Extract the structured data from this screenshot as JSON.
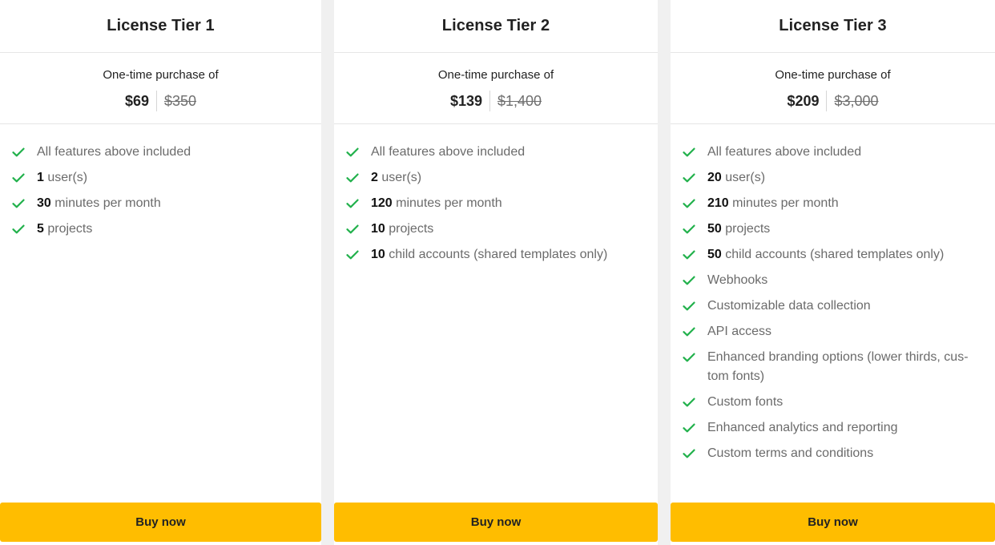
{
  "tiers": [
    {
      "title": "License Tier 1",
      "price_caption": "One-time purchase of",
      "price_now": "$69",
      "price_old": "$350",
      "features": [
        {
          "bold": "",
          "text": "All features above included"
        },
        {
          "bold": "1",
          "text": " user(s)"
        },
        {
          "bold": "30",
          "text": " minutes per month"
        },
        {
          "bold": "5",
          "text": " projects"
        }
      ],
      "button_label": "Buy now"
    },
    {
      "title": "License Tier 2",
      "price_caption": "One-time purchase of",
      "price_now": "$139",
      "price_old": "$1,400",
      "features": [
        {
          "bold": "",
          "text": "All features above included"
        },
        {
          "bold": "2",
          "text": " user(s)"
        },
        {
          "bold": "120",
          "text": " minutes per month"
        },
        {
          "bold": "10",
          "text": " projects"
        },
        {
          "bold": "10",
          "text": " child accounts (shared templates only)"
        }
      ],
      "button_label": "Buy now"
    },
    {
      "title": "License Tier 3",
      "price_caption": "One-time purchase of",
      "price_now": "$209",
      "price_old": "$3,000",
      "features": [
        {
          "bold": "",
          "text": "All features above included"
        },
        {
          "bold": "20",
          "text": " user(s)"
        },
        {
          "bold": "210",
          "text": " minutes per month"
        },
        {
          "bold": "50",
          "text": " projects"
        },
        {
          "bold": "50",
          "text": " child accounts (shared templates only)"
        },
        {
          "bold": "",
          "text": "Webhooks"
        },
        {
          "bold": "",
          "text": "Customizable data collection"
        },
        {
          "bold": "",
          "text": "API access"
        },
        {
          "bold": "",
          "text": "Enhanced branding options (lower thirds, cus-tom fonts)"
        },
        {
          "bold": "",
          "text": "Custom fonts"
        },
        {
          "bold": "",
          "text": "Enhanced analytics and reporting"
        },
        {
          "bold": "",
          "text": "Custom terms and conditions"
        }
      ],
      "button_label": "Buy now"
    }
  ],
  "colors": {
    "check": "#22b14c",
    "button": "#ffbd00",
    "background": "#f0f0f0"
  },
  "icons": {
    "feature": "checkmark-icon"
  }
}
